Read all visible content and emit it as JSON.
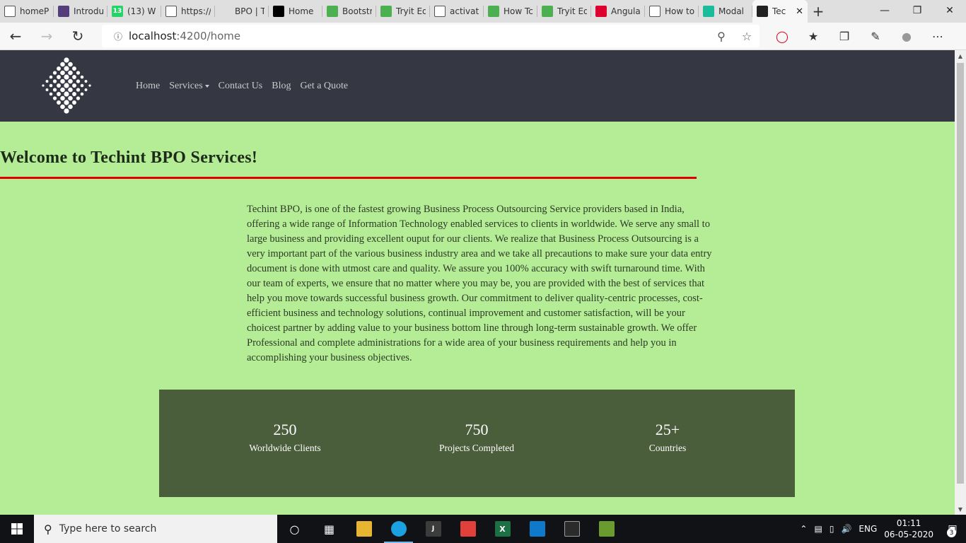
{
  "browser": {
    "tabs": [
      {
        "title": "homeP",
        "icon": "page-icon",
        "color": "#ffffff"
      },
      {
        "title": "Introdu",
        "icon": "bootstrap-icon",
        "color": "#563d7c"
      },
      {
        "title": "(13) W",
        "icon": "whatsapp-icon",
        "color": "#25d366",
        "badge": "13"
      },
      {
        "title": "https://",
        "icon": "page-icon",
        "color": "#ffffff"
      },
      {
        "title": "BPO | T",
        "icon": "blank-icon",
        "color": "#dfdfdf"
      },
      {
        "title": "Home",
        "icon": "wix-icon",
        "color": "#000000"
      },
      {
        "title": "Bootstr",
        "icon": "w3schools-icon",
        "color": "#4caf50"
      },
      {
        "title": "Tryit Ed",
        "icon": "w3schools-icon",
        "color": "#4caf50"
      },
      {
        "title": "activat",
        "icon": "google-icon",
        "color": "#ffffff"
      },
      {
        "title": "How Tc",
        "icon": "w3schools-icon",
        "color": "#4caf50"
      },
      {
        "title": "Tryit Ed",
        "icon": "w3schools-icon",
        "color": "#4caf50"
      },
      {
        "title": "Angula",
        "icon": "angular-icon",
        "color": "#dd0031"
      },
      {
        "title": "How to",
        "icon": "page-icon",
        "color": "#ffffff"
      },
      {
        "title": "Modal",
        "icon": "teal-icon",
        "color": "#1abc9c"
      },
      {
        "title": "Tec",
        "icon": "techint-icon",
        "color": "#222222",
        "active": true
      }
    ],
    "new_tab_label": "+",
    "address": {
      "host": "localhost",
      "path": ":4200/home"
    }
  },
  "site": {
    "nav": {
      "items": [
        {
          "label": "Home"
        },
        {
          "label": "Services",
          "has_dropdown": true
        },
        {
          "label": "Contact Us"
        },
        {
          "label": "Blog"
        },
        {
          "label": "Get a Quote"
        }
      ]
    },
    "welcome_title": "Welcome to Techint BPO Services!",
    "about_text": "Techint BPO, is one of the fastest growing Business Process Outsourcing Service providers based in India, offering a wide range of Information Technology enabled services to clients in worldwide. We serve any small to large business and providing excellent ouput for our clients. We realize that Business Process Outsourcing is a very important part of the various business industry area and we take all precautions to make sure your data entry document is done with utmost care and quality. We assure you 100% accuracy with swift turnaround time. With our team of experts, we ensure that no matter where you may be, you are provided with the best of services that help you move towards successful business growth. Our commitment to deliver quality-centric processes, cost-efficient business and technology solutions, continual improvement and customer satisfaction, will be your choicest partner by adding value to your business bottom line through long-term sustainable growth. We offer Professional and complete administrations for a wide area of your business requirements and help you in accomplishing your business objectives.",
    "stats": [
      {
        "value": "250",
        "label": "Worldwide Clients"
      },
      {
        "value": "750",
        "label": "Projects Completed"
      },
      {
        "value": "25+",
        "label": "Countries"
      }
    ],
    "colors": {
      "nav_bg": "#353842",
      "page_bg": "#b5ed96",
      "accent_line": "#e00000",
      "stats_bg": "#4b5e3b"
    }
  },
  "taskbar": {
    "search_placeholder": "Type here to search",
    "language": "ENG",
    "time": "01:11",
    "date": "06-05-2020",
    "notification_count": "3"
  }
}
